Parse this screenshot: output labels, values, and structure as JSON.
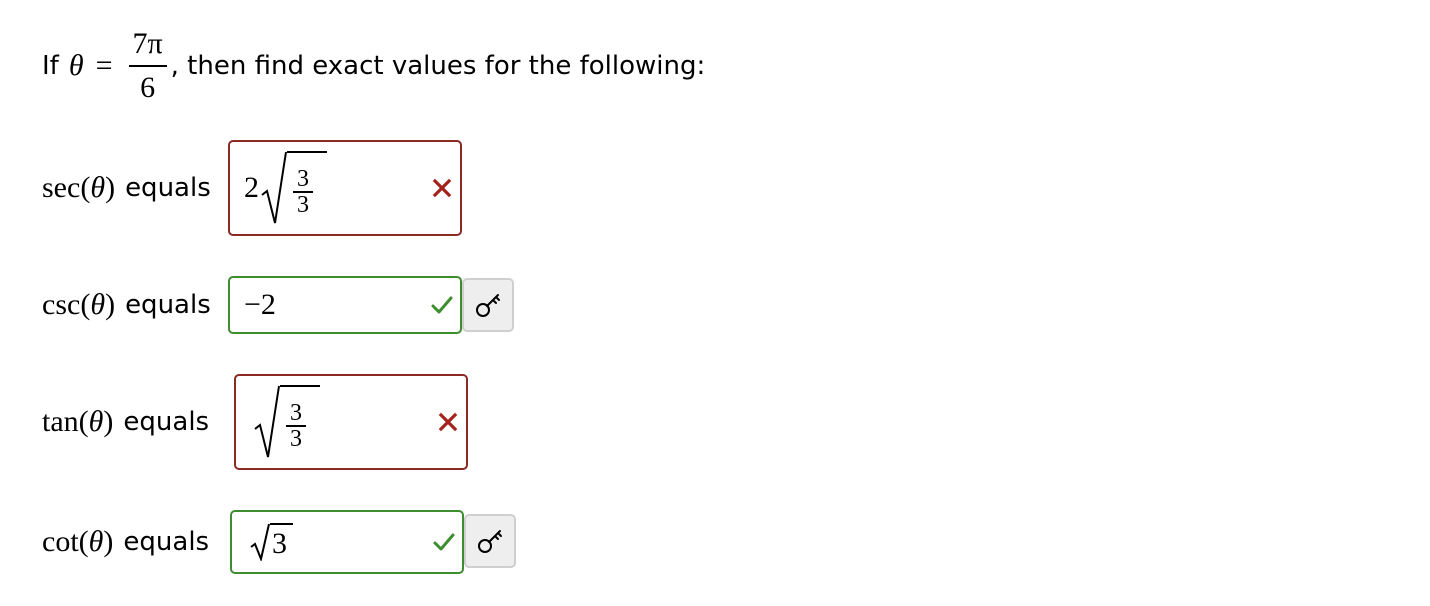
{
  "question": {
    "prefix": "If",
    "theta": "θ",
    "equals": "=",
    "frac_num": "7π",
    "frac_den": "6",
    "suffix": ", then find exact values for the following:"
  },
  "word_equals": "equals",
  "rows": [
    {
      "fn": "sec",
      "arg": "θ",
      "answer": {
        "coefficient": "2",
        "radicand_num": "3",
        "radicand_den": "3"
      },
      "status": "incorrect",
      "mark_icon": "cross-icon",
      "has_key": false
    },
    {
      "fn": "csc",
      "arg": "θ",
      "answer": {
        "text": "−2"
      },
      "status": "correct",
      "mark_icon": "check-icon",
      "has_key": true
    },
    {
      "fn": "tan",
      "arg": "θ",
      "answer": {
        "radicand_num": "3",
        "radicand_den": "3"
      },
      "status": "incorrect",
      "mark_icon": "cross-icon",
      "has_key": false
    },
    {
      "fn": "cot",
      "arg": "θ",
      "answer": {
        "radicand": "3"
      },
      "status": "correct",
      "mark_icon": "check-icon",
      "has_key": true
    }
  ],
  "colors": {
    "incorrect_border": "#8b2a24",
    "incorrect_mark": "#a3231c",
    "correct_border": "#3d8e2f",
    "correct_mark": "#3d8e2f",
    "key_button_bg": "#eeeeee"
  },
  "icons": {
    "key": "key-icon"
  }
}
